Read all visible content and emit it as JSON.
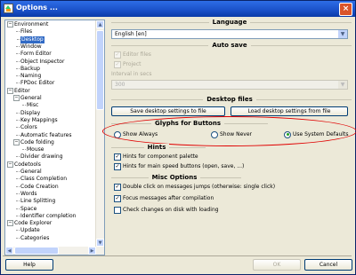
{
  "window": {
    "title": "Options ...",
    "close_glyph": "×"
  },
  "tree": {
    "items": [
      {
        "label": "Environment",
        "expander": "−",
        "indent": 0
      },
      {
        "label": "Files",
        "indent": 1
      },
      {
        "label": "Desktop",
        "indent": 1,
        "selected": true
      },
      {
        "label": "Window",
        "indent": 1
      },
      {
        "label": "Form Editor",
        "indent": 1
      },
      {
        "label": "Object Inspector",
        "indent": 1
      },
      {
        "label": "Backup",
        "indent": 1
      },
      {
        "label": "Naming",
        "indent": 1
      },
      {
        "label": "FPDoc Editor",
        "indent": 1
      },
      {
        "label": "Editor",
        "expander": "−",
        "indent": 0
      },
      {
        "label": "General",
        "expander": "−",
        "indent": 1
      },
      {
        "label": "Misc",
        "indent": 2
      },
      {
        "label": "Display",
        "indent": 1
      },
      {
        "label": "Key Mappings",
        "indent": 1
      },
      {
        "label": "Colors",
        "indent": 1
      },
      {
        "label": "Automatic features",
        "indent": 1
      },
      {
        "label": "Code folding",
        "expander": "−",
        "indent": 1
      },
      {
        "label": "Mouse",
        "indent": 2
      },
      {
        "label": "Divider drawing",
        "indent": 1
      },
      {
        "label": "Codetools",
        "expander": "−",
        "indent": 0
      },
      {
        "label": "General",
        "indent": 1
      },
      {
        "label": "Class Completion",
        "indent": 1
      },
      {
        "label": "Code Creation",
        "indent": 1
      },
      {
        "label": "Words",
        "indent": 1
      },
      {
        "label": "Line Splitting",
        "indent": 1
      },
      {
        "label": "Space",
        "indent": 1
      },
      {
        "label": "Identifier completion",
        "indent": 1
      },
      {
        "label": "Code Explorer",
        "expander": "−",
        "indent": 0
      },
      {
        "label": "Update",
        "indent": 1
      },
      {
        "label": "Categories",
        "indent": 1
      }
    ]
  },
  "language": {
    "title": "Language",
    "value": "English [en]"
  },
  "autosave": {
    "title": "Auto save",
    "editor_files": "Editor files",
    "project": "Project",
    "interval_label": "Interval in secs",
    "interval_value": "300"
  },
  "desktop_files": {
    "title": "Desktop files",
    "save_btn": "Save desktop settings to file",
    "load_btn": "Load desktop settings from file"
  },
  "glyphs": {
    "title": "Glyphs for Buttons",
    "options": [
      "Show Always",
      "Show Never",
      "Use System Defaults"
    ],
    "selected": 2
  },
  "hints": {
    "title": "Hints",
    "items": [
      "Hints for component palette",
      "Hints for main speed buttons (open, save, ...)"
    ]
  },
  "misc": {
    "title": "Misc Options",
    "items": [
      {
        "label": "Double click on messages jumps (otherwise: single click)",
        "checked": true
      },
      {
        "label": "Focus messages after compilation",
        "checked": true
      },
      {
        "label": "Check changes on disk with loading",
        "checked": false
      }
    ]
  },
  "footer": {
    "help": "Help",
    "ok": "OK",
    "cancel": "Cancel"
  },
  "colors": {
    "accent": "#316ac5",
    "annotation": "#e00000",
    "radio_on": "#21a121"
  }
}
